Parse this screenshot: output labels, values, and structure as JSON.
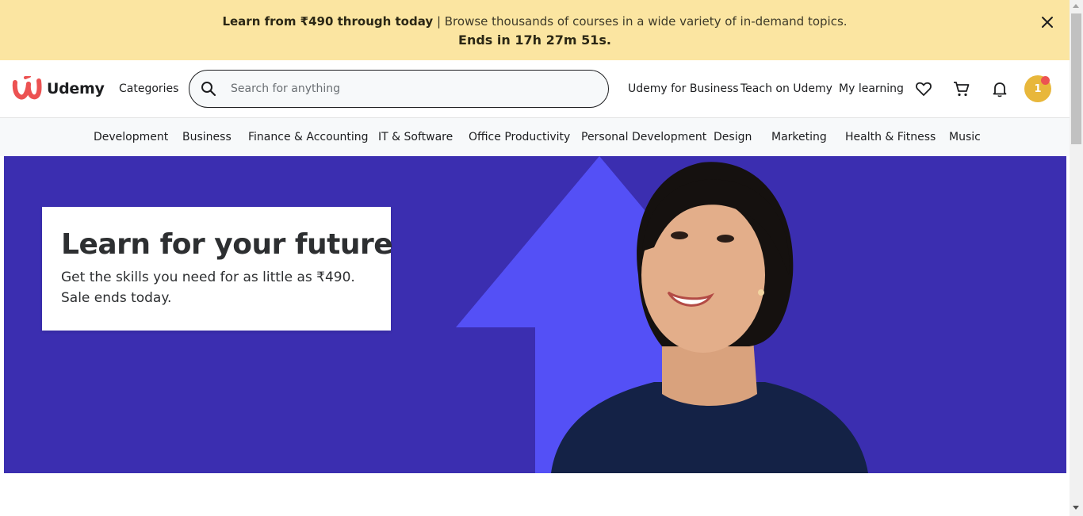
{
  "promo": {
    "bold_text": "Learn from ₹490 through today",
    "separator": " | ",
    "rest_text": "Browse thousands of courses in a wide variety of in-demand topics.",
    "countdown": "Ends in 17h 27m 51s.",
    "close_icon": "close-icon"
  },
  "header": {
    "logo_text": "Udemy",
    "categories_label": "Categories",
    "search": {
      "placeholder": "Search for anything",
      "value": ""
    },
    "links": {
      "business": "Udemy for Business",
      "teach": "Teach on Udemy",
      "my_learning": "My learning"
    },
    "icons": [
      "heart-icon",
      "cart-icon",
      "bell-icon"
    ],
    "avatar_initial": "1",
    "colors": {
      "brand": "#a435f0",
      "logo_mark": "#ec5252",
      "avatar": "#e8b73b",
      "notification_dot": "#ec5252"
    }
  },
  "category_nav": {
    "items": [
      "Development",
      "Business",
      "Finance & Accounting",
      "IT & Software",
      "Office Productivity",
      "Personal Development",
      "Design",
      "Marketing",
      "Health & Fitness",
      "Music"
    ]
  },
  "hero": {
    "title": "Learn for your future",
    "subtitle": "Get the skills you need for as little as ₹490. Sale ends today.",
    "colors": {
      "background": "#3b2eb0",
      "arrow": "#5450f6"
    }
  }
}
